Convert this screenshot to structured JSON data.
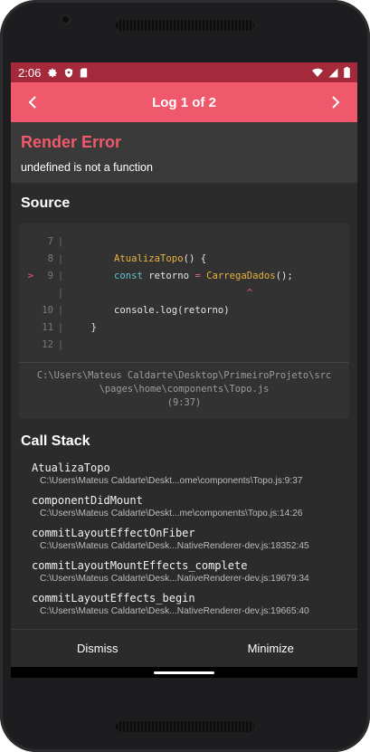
{
  "status_bar": {
    "time": "2:06",
    "icons_left": [
      "gear-icon",
      "shield-icon",
      "sd-card-icon"
    ],
    "icons_right": [
      "wifi-icon",
      "signal-icon",
      "battery-icon"
    ]
  },
  "header": {
    "title": "Log 1 of 2",
    "prev_icon": "chevron-left-icon",
    "next_icon": "chevron-right-icon"
  },
  "error": {
    "title": "Render Error",
    "message": "undefined is not a function"
  },
  "source": {
    "section_title": "Source",
    "lines": [
      {
        "marker": "",
        "num": "7",
        "code": ""
      },
      {
        "marker": "",
        "num": "8",
        "code": "        AtualizaTopo() {"
      },
      {
        "marker": ">",
        "num": "9",
        "code": "        const retorno = CarregaDados();"
      },
      {
        "marker": "",
        "num": "",
        "code": "                               ^"
      },
      {
        "marker": "",
        "num": "10",
        "code": "        console.log(retorno)"
      },
      {
        "marker": "",
        "num": "11",
        "code": "    }"
      },
      {
        "marker": "",
        "num": "12",
        "code": ""
      }
    ],
    "file": "C:\\Users\\Mateus Caldarte\\Desktop\\PrimeiroProjeto\\src\\pages\\home\\components\\Topo.js",
    "position": "(9:37)"
  },
  "call_stack": {
    "section_title": "Call Stack",
    "frames": [
      {
        "name": "AtualizaTopo",
        "file": "C:\\Users\\Mateus Caldarte\\Deskt...ome\\components\\Topo.js:9:37"
      },
      {
        "name": "componentDidMount",
        "file": "C:\\Users\\Mateus Caldarte\\Deskt...me\\components\\Topo.js:14:26"
      },
      {
        "name": "commitLayoutEffectOnFiber",
        "file": "C:\\Users\\Mateus Caldarte\\Desk...NativeRenderer-dev.js:18352:45"
      },
      {
        "name": "commitLayoutMountEffects_complete",
        "file": "C:\\Users\\Mateus Caldarte\\Desk...NativeRenderer-dev.js:19679:34"
      },
      {
        "name": "commitLayoutEffects_begin",
        "file": "C:\\Users\\Mateus Caldarte\\Desk...NativeRenderer-dev.js:19665:40"
      }
    ]
  },
  "footer": {
    "dismiss_label": "Dismiss",
    "minimize_label": "Minimize"
  },
  "colors": {
    "status_bar": "#a42a3b",
    "header": "#f0596c",
    "error_title": "#f0596c",
    "background": "#2b2b2b"
  }
}
